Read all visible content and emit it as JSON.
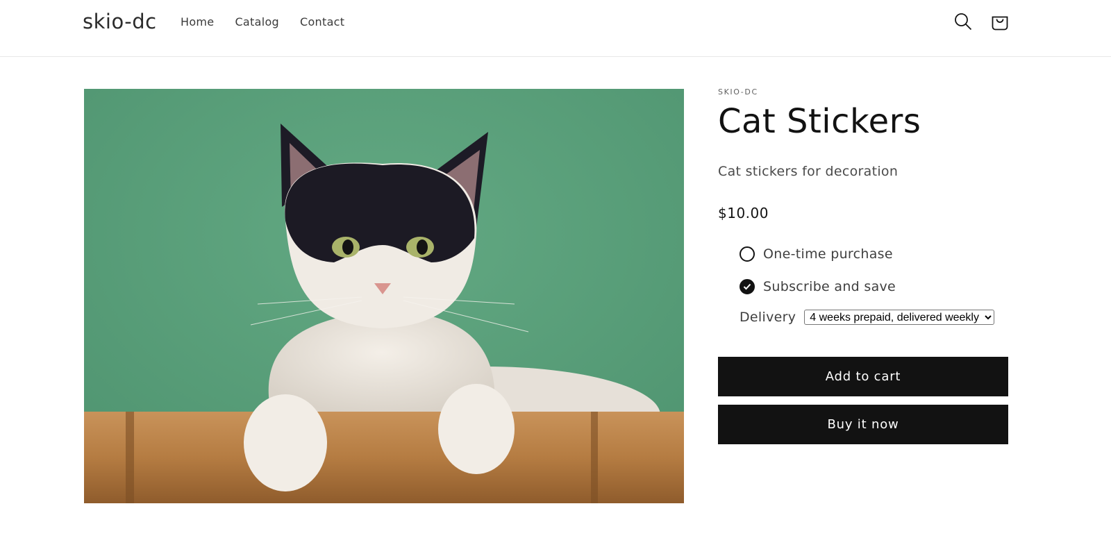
{
  "header": {
    "logo": "skio-dc",
    "nav": [
      "Home",
      "Catalog",
      "Contact"
    ]
  },
  "product": {
    "vendor": "SKIO-DC",
    "title": "Cat Stickers",
    "description": "Cat stickers for decoration",
    "price": "$10.00",
    "purchase_options": [
      {
        "label": "One-time purchase",
        "checked": false
      },
      {
        "label": "Subscribe and save",
        "checked": true
      }
    ],
    "delivery_label": "Delivery",
    "delivery_selected": "4 weeks prepaid, delivered weekly",
    "add_to_cart": "Add to cart",
    "buy_now": "Buy it now"
  },
  "colors": {
    "button_bg": "#121212",
    "button_text": "#ffffff",
    "image_background": "#5aa07a"
  },
  "icons": [
    "search-icon",
    "cart-icon",
    "checkmark-icon"
  ]
}
